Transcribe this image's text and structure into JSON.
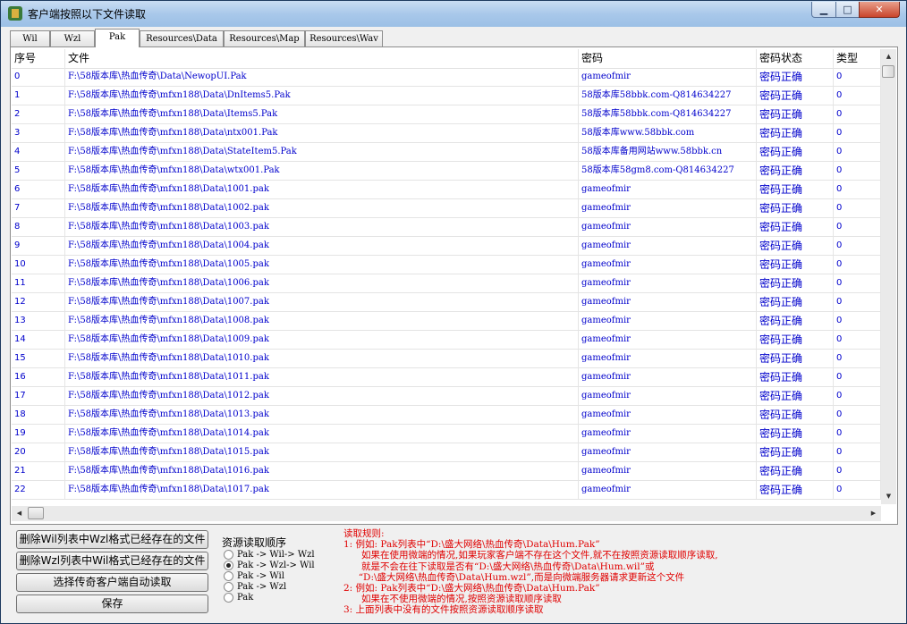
{
  "window": {
    "title": "客户端按照以下文件读取",
    "min": "▁",
    "max": "□",
    "close": "✕"
  },
  "tabs": [
    "Wil",
    "Wzl",
    "Pak",
    "Resources\\Data",
    "Resources\\Map",
    "Resources\\Wav"
  ],
  "active_tab": "Pak",
  "table": {
    "columns": [
      "序号",
      "文件",
      "密码",
      "密码状态",
      "类型"
    ],
    "rows": [
      [
        "0",
        "F:\\58版本库\\热血传奇\\Data\\NewopUI.Pak",
        "gameofmir",
        "密码正确",
        "0"
      ],
      [
        "1",
        "F:\\58版本库\\热血传奇\\mfxn188\\Data\\DnItems5.Pak",
        "58版本库58bbk.com-Q814634227",
        "密码正确",
        "0"
      ],
      [
        "2",
        "F:\\58版本库\\热血传奇\\mfxn188\\Data\\Items5.Pak",
        "58版本库58bbk.com-Q814634227",
        "密码正确",
        "0"
      ],
      [
        "3",
        "F:\\58版本库\\热血传奇\\mfxn188\\Data\\ntx001.Pak",
        "58版本库www.58bbk.com",
        "密码正确",
        "0"
      ],
      [
        "4",
        "F:\\58版本库\\热血传奇\\mfxn188\\Data\\StateItem5.Pak",
        "58版本库备用网站www.58bbk.cn",
        "密码正确",
        "0"
      ],
      [
        "5",
        "F:\\58版本库\\热血传奇\\mfxn188\\Data\\wtx001.Pak",
        "58版本库58gm8.com-Q814634227",
        "密码正确",
        "0"
      ],
      [
        "6",
        "F:\\58版本库\\热血传奇\\mfxn188\\Data\\1001.pak",
        "gameofmir",
        "密码正确",
        "0"
      ],
      [
        "7",
        "F:\\58版本库\\热血传奇\\mfxn188\\Data\\1002.pak",
        "gameofmir",
        "密码正确",
        "0"
      ],
      [
        "8",
        "F:\\58版本库\\热血传奇\\mfxn188\\Data\\1003.pak",
        "gameofmir",
        "密码正确",
        "0"
      ],
      [
        "9",
        "F:\\58版本库\\热血传奇\\mfxn188\\Data\\1004.pak",
        "gameofmir",
        "密码正确",
        "0"
      ],
      [
        "10",
        "F:\\58版本库\\热血传奇\\mfxn188\\Data\\1005.pak",
        "gameofmir",
        "密码正确",
        "0"
      ],
      [
        "11",
        "F:\\58版本库\\热血传奇\\mfxn188\\Data\\1006.pak",
        "gameofmir",
        "密码正确",
        "0"
      ],
      [
        "12",
        "F:\\58版本库\\热血传奇\\mfxn188\\Data\\1007.pak",
        "gameofmir",
        "密码正确",
        "0"
      ],
      [
        "13",
        "F:\\58版本库\\热血传奇\\mfxn188\\Data\\1008.pak",
        "gameofmir",
        "密码正确",
        "0"
      ],
      [
        "14",
        "F:\\58版本库\\热血传奇\\mfxn188\\Data\\1009.pak",
        "gameofmir",
        "密码正确",
        "0"
      ],
      [
        "15",
        "F:\\58版本库\\热血传奇\\mfxn188\\Data\\1010.pak",
        "gameofmir",
        "密码正确",
        "0"
      ],
      [
        "16",
        "F:\\58版本库\\热血传奇\\mfxn188\\Data\\1011.pak",
        "gameofmir",
        "密码正确",
        "0"
      ],
      [
        "17",
        "F:\\58版本库\\热血传奇\\mfxn188\\Data\\1012.pak",
        "gameofmir",
        "密码正确",
        "0"
      ],
      [
        "18",
        "F:\\58版本库\\热血传奇\\mfxn188\\Data\\1013.pak",
        "gameofmir",
        "密码正确",
        "0"
      ],
      [
        "19",
        "F:\\58版本库\\热血传奇\\mfxn188\\Data\\1014.pak",
        "gameofmir",
        "密码正确",
        "0"
      ],
      [
        "20",
        "F:\\58版本库\\热血传奇\\mfxn188\\Data\\1015.pak",
        "gameofmir",
        "密码正确",
        "0"
      ],
      [
        "21",
        "F:\\58版本库\\热血传奇\\mfxn188\\Data\\1016.pak",
        "gameofmir",
        "密码正确",
        "0"
      ],
      [
        "22",
        "F:\\58版本库\\热血传奇\\mfxn188\\Data\\1017.pak",
        "gameofmir",
        "密码正确",
        "0"
      ]
    ]
  },
  "buttons": {
    "delete_wil": "删除Wil列表中Wzl格式已经存在的文件",
    "delete_wzl": "删除Wzl列表中Wil格式已经存在的文件",
    "auto_read": "选择传奇客户端自动读取",
    "save": "保存"
  },
  "read_order": {
    "title": "资源读取顺序",
    "options": [
      "Pak -> Wil-> Wzl",
      "Pak -> Wzl-> Wil",
      "Pak -> Wil",
      "Pak -> Wzl",
      "Pak"
    ],
    "selected": 1
  },
  "rules": [
    "读取规则:",
    "1: 例如: Pak列表中“D:\\盛大网络\\热血传奇\\Data\\Hum.Pak”",
    "      如果在使用微端的情况,如果玩家客户端不存在这个文件,就不在按照资源读取顺序读取,",
    "      就是不会在往下读取是否有“D:\\盛大网络\\热血传奇\\Data\\Hum.wil”或",
    "     “D:\\盛大网络\\热血传奇\\Data\\Hum.wzl”,而是向微端服务器请求更新这个文件",
    "2: 例如: Pak列表中“D:\\盛大网络\\热血传奇\\Data\\Hum.Pak”",
    "      如果在不使用微端的情况,按照资源读取顺序读取",
    "3: 上面列表中没有的文件按照资源读取顺序读取"
  ],
  "colors": {
    "link_text": "#0000cc",
    "rules_text": "#e00000"
  }
}
